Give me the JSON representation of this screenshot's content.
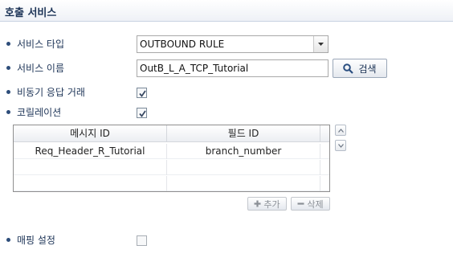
{
  "section": {
    "title": "호출 서비스"
  },
  "service_type": {
    "label": "서비스 타입",
    "value": "OUTBOUND RULE"
  },
  "service_name": {
    "label": "서비스 이름",
    "value": "OutB_L_A_TCP_Tutorial",
    "search_label": "검색"
  },
  "async": {
    "label": "비동기 응답 거래",
    "checked": true
  },
  "correlation": {
    "label": "코릴레이션",
    "checked": true,
    "columns": [
      "메시지 ID",
      "필드 ID"
    ],
    "rows": [
      {
        "message_id": "Req_Header_R_Tutorial",
        "field_id": "branch_number"
      },
      {
        "message_id": "",
        "field_id": ""
      },
      {
        "message_id": "",
        "field_id": ""
      }
    ],
    "add_label": "추가",
    "delete_label": "삭제"
  },
  "mapping": {
    "label": "매핑 설정",
    "checked": false
  }
}
